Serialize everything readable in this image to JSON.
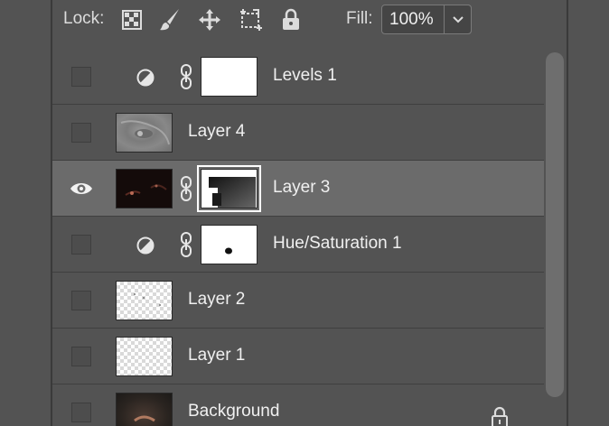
{
  "toolbar": {
    "lock_label": "Lock:",
    "lock_icons": [
      "lock-transparent-pixels-icon",
      "lock-image-pixels-icon",
      "lock-position-icon",
      "prevent-autonest-icon",
      "lock-all-icon"
    ],
    "fill_label": "Fill:",
    "fill_value": "100%"
  },
  "layers": [
    {
      "name": "Levels 1",
      "visible": false,
      "kind": "adjustment",
      "mask": "white"
    },
    {
      "name": "Layer 4",
      "visible": false,
      "kind": "pixel",
      "thumb": "gray-texture"
    },
    {
      "name": "Layer 3",
      "visible": true,
      "kind": "pixel",
      "thumb": "dark-photo",
      "mask": "gradient",
      "selected": true
    },
    {
      "name": "Hue/Saturation 1",
      "visible": false,
      "kind": "adjustment",
      "mask": "white-with-spot"
    },
    {
      "name": "Layer 2",
      "visible": false,
      "kind": "pixel",
      "thumb": "transparent"
    },
    {
      "name": "Layer 1",
      "visible": false,
      "kind": "pixel",
      "thumb": "transparent"
    },
    {
      "name": "Background",
      "visible": false,
      "kind": "background",
      "thumb": "photo",
      "locked": true
    }
  ],
  "colors": {
    "panel_bg": "#535353",
    "selected_row_bg": "#6b6b6b",
    "text": "#f0f0f0"
  }
}
